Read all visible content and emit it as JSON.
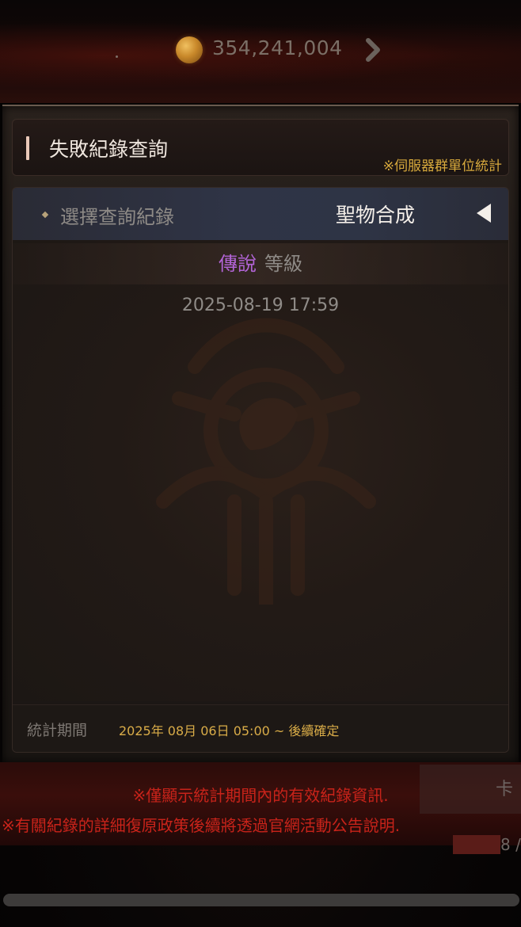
{
  "topbar": {
    "currency_amount": "354,241,004",
    "currency_icon": "gold-coin-icon",
    "next_icon": "chevron-right-icon"
  },
  "header": {
    "title": "失敗紀錄查詢",
    "note": "※伺服器群單位統計"
  },
  "selector": {
    "label": "選擇查詢紀錄",
    "value": "聖物合成",
    "arrow_icon": "triangle-left-icon"
  },
  "record": {
    "grade": "傳說",
    "grade_suffix": "等級",
    "grade_color": "#b264d6",
    "date": "2025-08-19 17:59"
  },
  "footer": {
    "label": "統計期間",
    "period": "2025年 08月 06日 05:00 ~ 後續確定"
  },
  "notices": {
    "line1": "※僅顯示統計期間內的有效紀錄資訊.",
    "line2": "※有關紀錄的詳細復原政策後續將透過官網活動公告說明.",
    "color": "#c8231a"
  },
  "side": {
    "card_text": "卡",
    "count_text": "8 /"
  }
}
